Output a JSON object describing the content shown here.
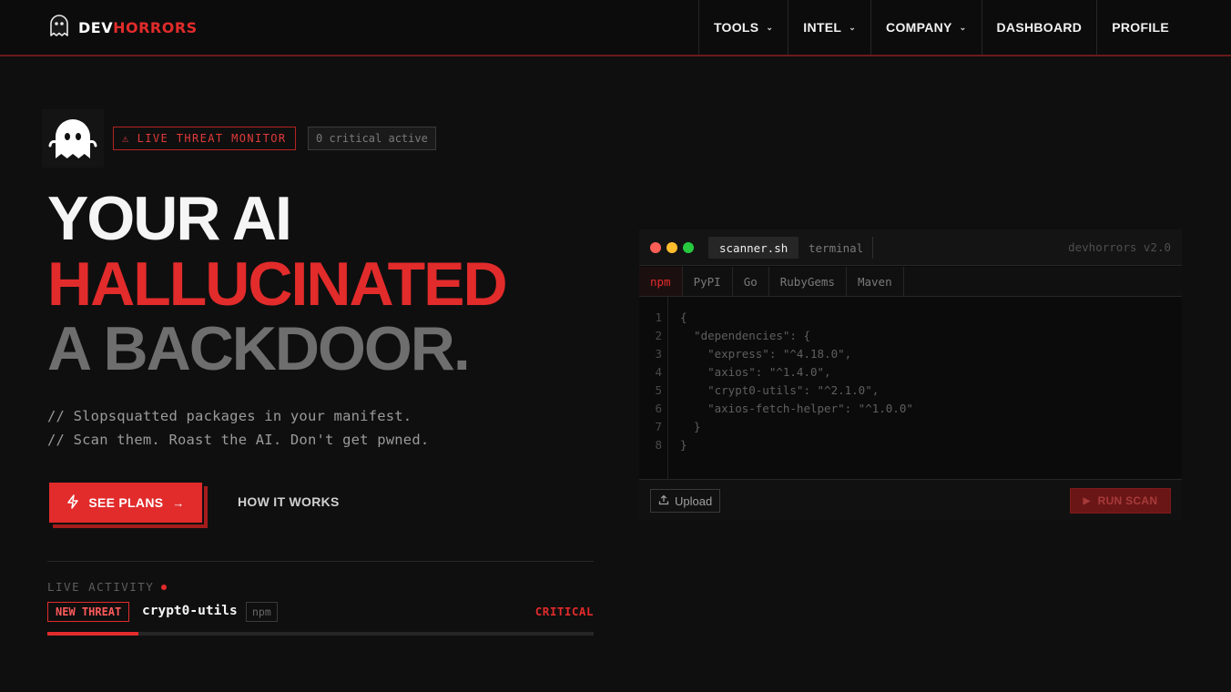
{
  "brand": {
    "part1": "DEV",
    "part2": "HORRORS"
  },
  "nav": {
    "items": [
      {
        "label": "TOOLS",
        "dropdown": true
      },
      {
        "label": "INTEL",
        "dropdown": true
      },
      {
        "label": "COMPANY",
        "dropdown": true
      },
      {
        "label": "DASHBOARD",
        "dropdown": false
      },
      {
        "label": "PROFILE",
        "dropdown": false
      }
    ]
  },
  "hero": {
    "badge_live": "LIVE THREAT MONITOR",
    "badge_count": "0 critical active",
    "headline": [
      "YOUR AI",
      "HALLUCINATED",
      "A BACKDOOR."
    ],
    "sub": [
      "// Slopsquatted packages in your manifest.",
      "// Scan them. Roast the AI. Don't get pwned."
    ],
    "cta_primary": "SEE PLANS",
    "cta_secondary": "HOW IT WORKS"
  },
  "activity": {
    "label": "LIVE ACTIVITY",
    "tag": "NEW THREAT",
    "package": "crypt0-utils",
    "ecosystem": "npm",
    "severity": "CRITICAL",
    "progress": 0.1667
  },
  "scanner": {
    "tab_active": "scanner.sh",
    "tab_other": "terminal",
    "version": "devhorrors v2.0",
    "ecosystems": [
      "npm",
      "PyPI",
      "Go",
      "RubyGems",
      "Maven"
    ],
    "active_ecosystem": "npm",
    "code": [
      "{",
      "  \"dependencies\": {",
      "    \"express\": \"^4.18.0\",",
      "    \"axios\": \"^1.4.0\",",
      "    \"crypt0-utils\": \"^2.1.0\",",
      "    \"axios-fetch-helper\": \"^1.0.0\"",
      "  }",
      "}"
    ],
    "line_numbers": [
      "1",
      "2",
      "3",
      "4",
      "5",
      "6",
      "7",
      "8"
    ],
    "upload": "Upload",
    "run": "RUN SCAN"
  },
  "colors": {
    "accent": "#e22b2b",
    "bg": "#0f0f0f",
    "muted": "#6e6e6e",
    "dot_red": "#ff5f56",
    "dot_yellow": "#ffbd2e",
    "dot_green": "#27c93f"
  },
  "icons": [
    "ghost-icon",
    "warning-icon",
    "bolt-icon",
    "arrow-right-icon",
    "chevron-down-icon",
    "upload-icon",
    "play-icon"
  ]
}
